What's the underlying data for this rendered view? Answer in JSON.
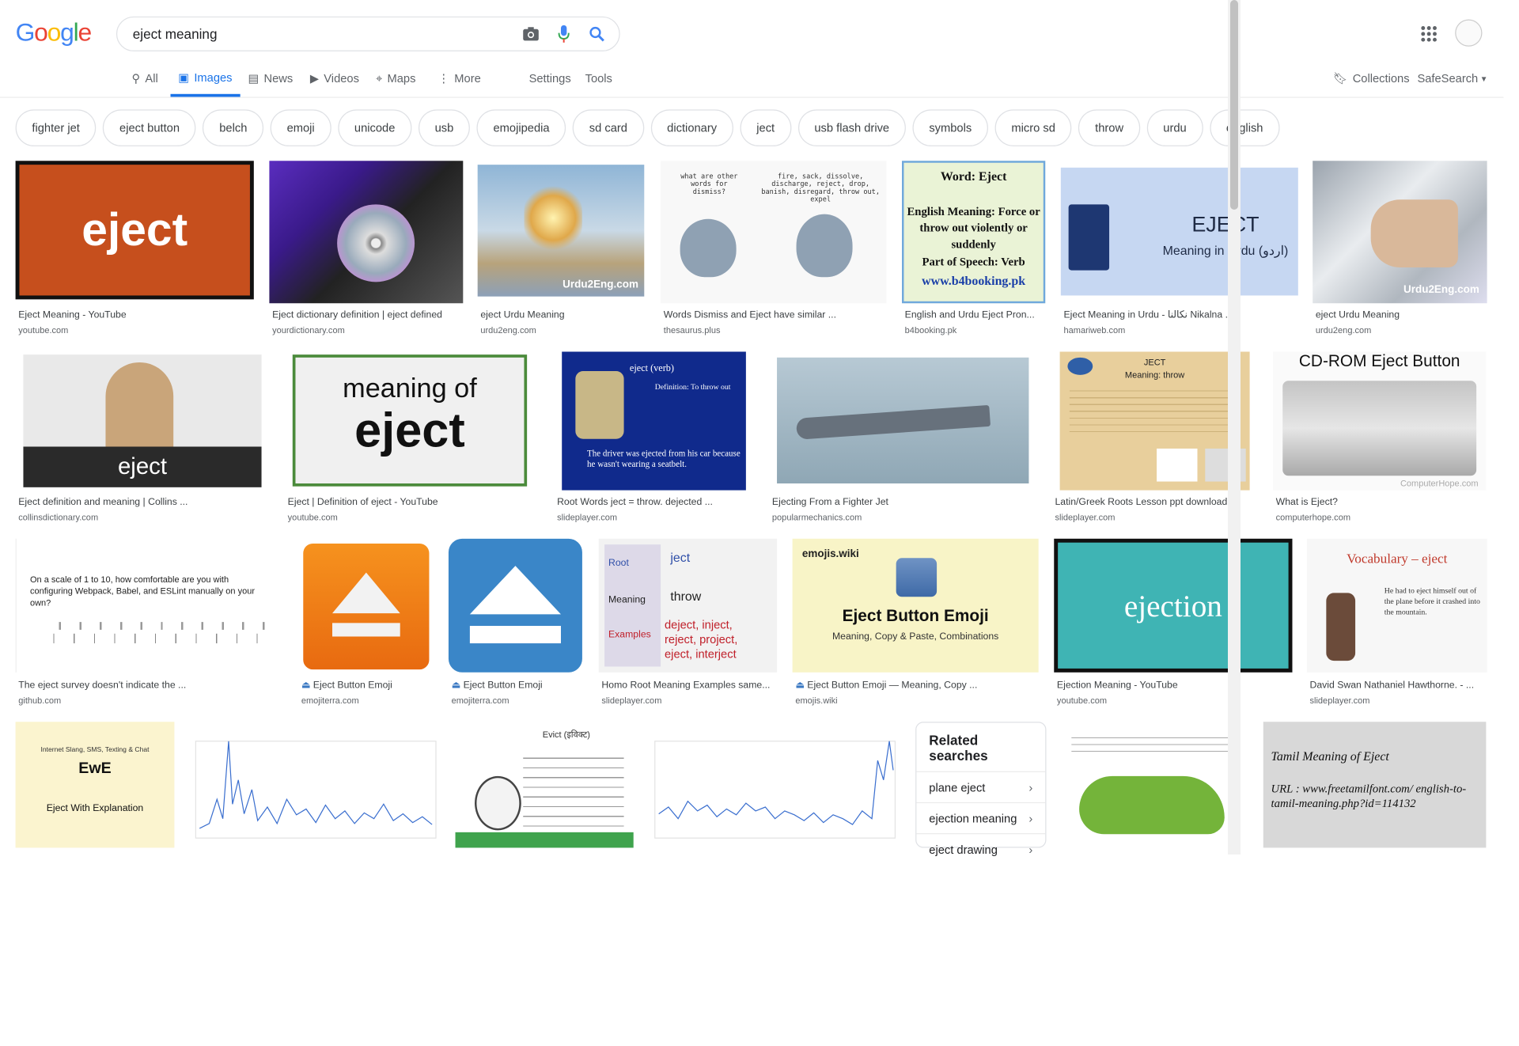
{
  "search": {
    "query": "eject meaning"
  },
  "logo": {
    "text": "Google"
  },
  "tabs": [
    {
      "label": "All",
      "icon": "search-icon"
    },
    {
      "label": "Images",
      "icon": "image-icon"
    },
    {
      "label": "News",
      "icon": "news-icon"
    },
    {
      "label": "Videos",
      "icon": "video-icon"
    },
    {
      "label": "Maps",
      "icon": "map-icon"
    },
    {
      "label": "More",
      "icon": "more-icon"
    }
  ],
  "tools": {
    "settings": "Settings",
    "tools": "Tools",
    "collections": "Collections",
    "safesearch": "SafeSearch"
  },
  "chips": [
    "fighter jet",
    "eject button",
    "belch",
    "emoji",
    "unicode",
    "usb",
    "emojipedia",
    "sd card",
    "dictionary",
    "ject",
    "usb flash drive",
    "symbols",
    "micro sd",
    "throw",
    "urdu",
    "english"
  ],
  "results": [
    {
      "title": "Eject Meaning - YouTube",
      "source": "youtube.com",
      "label": "eject"
    },
    {
      "title": "Eject dictionary definition | eject defined",
      "source": "yourdictionary.com"
    },
    {
      "title": "eject Urdu Meaning",
      "source": "urdu2eng.com",
      "label": "Urdu2Eng.com"
    },
    {
      "title": "Words Dismiss and Eject have similar ...",
      "source": "thesaurus.plus",
      "label": "what are other words for dismiss?",
      "label2": "fire, sack, dissolve, discharge, reject, drop, banish, disregard, throw out, expel"
    },
    {
      "title": "English and Urdu Eject Pron...",
      "source": "b4booking.pk",
      "label": "Word: Eject",
      "label2": "English Meaning: Force or throw out violently or suddenly",
      "label3": "Part of Speech: Verb",
      "label4": "www.b4booking.pk"
    },
    {
      "title": "Eject Meaning in Urdu - نکالنا Nikalna ...",
      "source": "hamariweb.com",
      "label": "EJECT",
      "label2": "Meaning in Urdu (اردو)"
    },
    {
      "title": "eject Urdu Meaning",
      "source": "urdu2eng.com",
      "label": "Urdu2Eng.com"
    },
    {
      "title": "Eject definition and meaning | Collins ...",
      "source": "collinsdictionary.com",
      "label": "eject"
    },
    {
      "title": "Eject | Definition of eject - YouTube",
      "source": "youtube.com",
      "label": "meaning of",
      "label2": "eject"
    },
    {
      "title": "Root Words ject = throw. dejected ...",
      "source": "slideplayer.com",
      "label": "eject (verb)",
      "label2": "Definition: To throw out",
      "label3": "The driver was ejected from his car because he wasn't wearing a seatbelt."
    },
    {
      "title": "Ejecting From a Fighter Jet",
      "source": "popularmechanics.com"
    },
    {
      "title": "Latin/Greek Roots Lesson ppt download",
      "source": "slideplayer.com",
      "label": "JECT",
      "label2": "Meaning: throw"
    },
    {
      "title": "What is Eject?",
      "source": "computerhope.com",
      "label": "CD-ROM Eject Button",
      "label2": "ComputerHope.com"
    },
    {
      "title": "The eject survey doesn't indicate the ...",
      "source": "github.com",
      "label": "On a scale of 1 to 10, how comfortable are you with configuring Webpack, Babel, and ESLint manually on your own?"
    },
    {
      "title": "Eject Button Emoji",
      "source": "emojiterra.com"
    },
    {
      "title": "Eject Button Emoji",
      "source": "emojiterra.com"
    },
    {
      "title": "Homo Root Meaning Examples same...",
      "source": "slideplayer.com",
      "label": "ject",
      "label2": "throw",
      "label3": "deject, inject, reject, project, eject, interject",
      "label4": "Root",
      "label5": "Meaning",
      "label6": "Examples"
    },
    {
      "title": "Eject Button Emoji — Meaning, Copy ...",
      "source": "emojis.wiki",
      "label": "emojis.wiki",
      "label2": "Eject Button Emoji",
      "label3": "Meaning, Copy & Paste, Combinations"
    },
    {
      "title": "Ejection Meaning - YouTube",
      "source": "youtube.com",
      "label": "ejection"
    },
    {
      "title": "David Swan Nathaniel Hawthorne. - ...",
      "source": "slideplayer.com",
      "label": "Vocabulary – eject",
      "label2": "He had to eject himself out of the plane before it crashed into the mountain."
    }
  ],
  "bottom": {
    "ewe": {
      "t1": "Internet Slang, SMS, Texting & Chat",
      "t2": "EwE",
      "t3": "Eject With Explanation"
    },
    "tamil": {
      "t1": "Tamil Meaning of Eject",
      "t2": "URL : www.freetamilfont.com/ english-to-tamil-meaning.php?id=114132"
    },
    "evict": {
      "t1": "Evict (इविक्ट)"
    }
  },
  "related": {
    "heading": "Related searches",
    "items": [
      "plane eject",
      "ejection meaning",
      "eject drawing"
    ]
  }
}
